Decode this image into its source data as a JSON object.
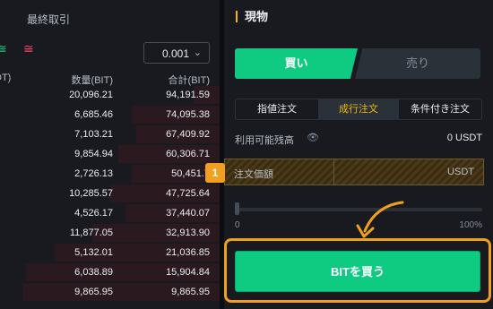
{
  "order_book": {
    "title": "最終取引",
    "icons": {
      "buy": "buy-orders-icon",
      "sell": "sell-orders-icon"
    },
    "precision": "0.001",
    "headers": {
      "price": "DT)",
      "quantity": "数量(BIT)",
      "total": "合計(BIT)"
    },
    "rows": [
      {
        "qty": "20,096.21",
        "total": "94,191.59",
        "depth": 0.12
      },
      {
        "qty": "6,685.46",
        "total": "74,095.38",
        "depth": 0.4
      },
      {
        "qty": "7,103.21",
        "total": "67,409.92",
        "depth": 0.38
      },
      {
        "qty": "9,854.94",
        "total": "60,306.71",
        "depth": 0.46
      },
      {
        "qty": "2,726.13",
        "total": "50,451.7",
        "depth": 0.4
      },
      {
        "qty": "10,285.57",
        "total": "47,725.64",
        "depth": 0.5
      },
      {
        "qty": "4,526.17",
        "total": "37,440.07",
        "depth": 0.43
      },
      {
        "qty": "11,877.05",
        "total": "32,913.90",
        "depth": 0.58
      },
      {
        "qty": "5,132.01",
        "total": "21,036.85",
        "depth": 0.75
      },
      {
        "qty": "6,038.89",
        "total": "15,904.84",
        "depth": 0.88
      },
      {
        "qty": "9,865.95",
        "total": "9,865.95",
        "depth": 0.9
      }
    ]
  },
  "spot": {
    "title": "現物",
    "tabs": {
      "buy": "買い",
      "sell": "売り"
    },
    "order_types": [
      "指値注文",
      "成行注文",
      "条件付き注文"
    ],
    "available_label": "利用可能残高",
    "available_value": "0 USDT",
    "amount_label": "注文価額",
    "amount_unit": "USDT",
    "step_badge": "1",
    "slider": {
      "min": "0",
      "max": "100%",
      "value": 0
    },
    "buy_button": "BITを買う"
  },
  "colors": {
    "buy": "#0ecb81",
    "sell": "#f6465d",
    "accent": "#f0b90b",
    "highlight": "#f0a01e"
  }
}
